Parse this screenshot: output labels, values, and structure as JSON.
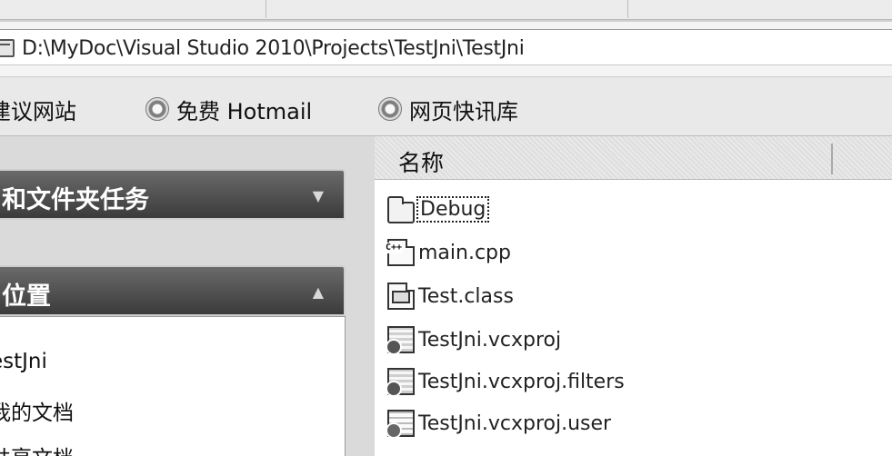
{
  "address_bar": {
    "path": "D:\\MyDoc\\Visual Studio 2010\\Projects\\TestJni\\TestJni"
  },
  "links_bar": {
    "items": [
      {
        "label": "建议网站",
        "icon": "ie-page-icon"
      },
      {
        "label": "免费 Hotmail",
        "icon": "ie-page-icon"
      },
      {
        "label": "网页快讯库",
        "icon": "ie-page-icon"
      }
    ]
  },
  "task_pane": {
    "file_folder_tasks_title": "和文件夹任务",
    "other_places_title": "位置",
    "other_places": [
      "estJni",
      "我的文档",
      "共享文档"
    ]
  },
  "file_list": {
    "column_name": "名称",
    "files": [
      {
        "name": "Debug",
        "icon": "folder-icon",
        "selected": true
      },
      {
        "name": "main.cpp",
        "icon": "cpp-file-icon"
      },
      {
        "name": "Test.class",
        "icon": "class-file-icon"
      },
      {
        "name": "TestJni.vcxproj",
        "icon": "vcxproj-file-icon"
      },
      {
        "name": "TestJni.vcxproj.filters",
        "icon": "vcxproj-filters-icon"
      },
      {
        "name": "TestJni.vcxproj.user",
        "icon": "vcxproj-user-icon"
      }
    ]
  }
}
